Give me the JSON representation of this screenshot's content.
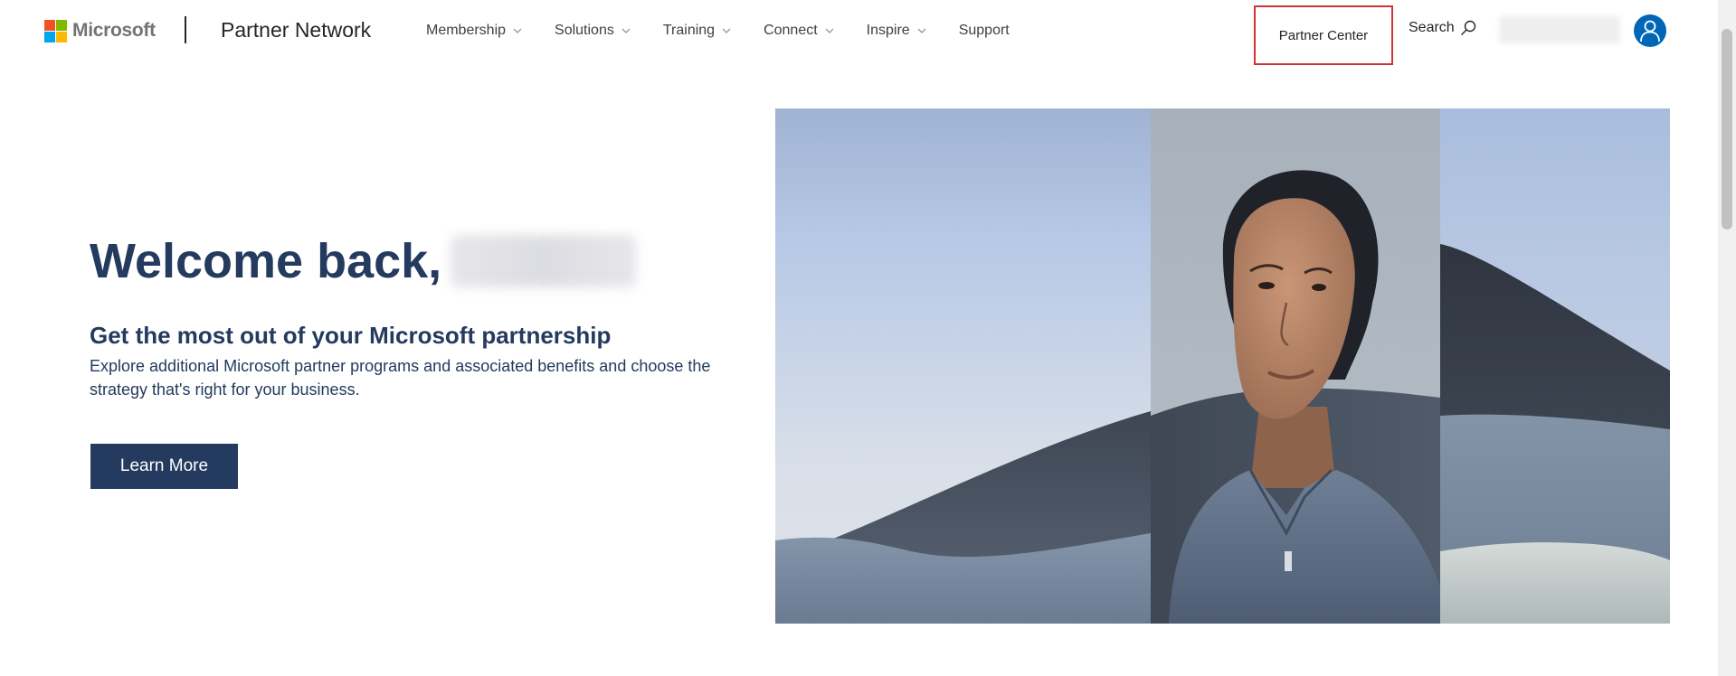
{
  "header": {
    "brand_logo": "Microsoft",
    "brand_name": "Partner Network",
    "nav": [
      {
        "label": "Membership",
        "has_dropdown": true
      },
      {
        "label": "Solutions",
        "has_dropdown": true
      },
      {
        "label": "Training",
        "has_dropdown": true
      },
      {
        "label": "Connect",
        "has_dropdown": true
      },
      {
        "label": "Inspire",
        "has_dropdown": true
      },
      {
        "label": "Support",
        "has_dropdown": false
      }
    ],
    "partner_center_label": "Partner Center",
    "search_label": "Search",
    "icons": [
      "microsoft-logo-icon",
      "chevron-down-icon",
      "search-icon",
      "user-avatar-icon"
    ]
  },
  "hero": {
    "welcome": "Welcome back,",
    "user_name_redacted": true,
    "subheading": "Get the most out of your Microsoft partnership",
    "description": "Explore additional Microsoft partner programs and associated benefits and choose the strategy that's right for your business.",
    "cta_label": "Learn More"
  },
  "colors": {
    "primary_navy": "#243a5e",
    "accent_blue": "#0067b8",
    "highlight_red": "#d13438",
    "ms_red": "#f25022",
    "ms_green": "#7fba00",
    "ms_blue": "#00a4ef",
    "ms_yellow": "#ffb900"
  }
}
